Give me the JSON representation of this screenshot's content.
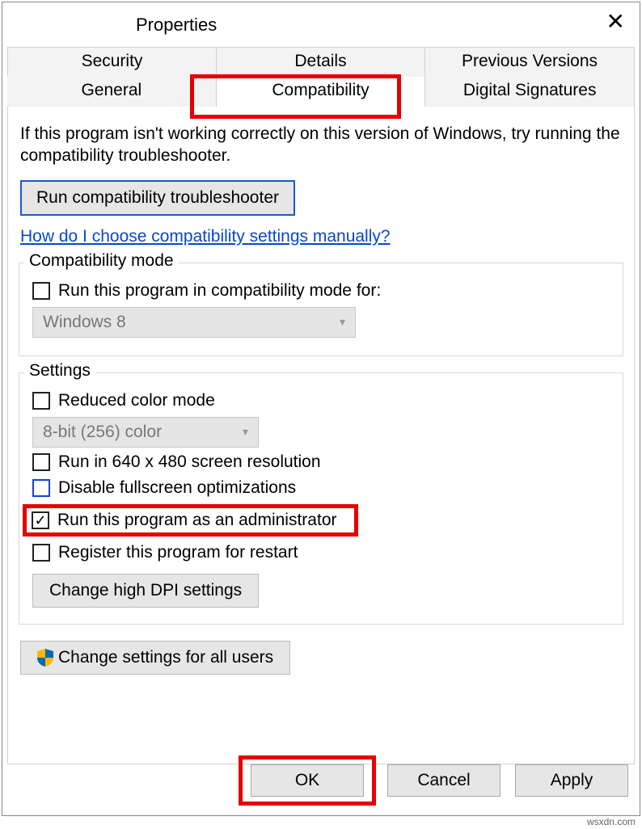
{
  "window": {
    "title": "Properties",
    "close": "✕"
  },
  "tabs": {
    "row1": [
      "Security",
      "Details",
      "Previous Versions"
    ],
    "row2": [
      "General",
      "Compatibility",
      "Digital Signatures"
    ],
    "active": "Compatibility"
  },
  "intro": "If this program isn't working correctly on this version of Windows, try running the compatibility troubleshooter.",
  "run_troubleshooter": "Run compatibility troubleshooter",
  "help_link": "How do I choose compatibility settings manually?",
  "compat_group": {
    "label": "Compatibility mode",
    "checkbox": "Run this program in compatibility mode for:",
    "combo_value": "Windows 8"
  },
  "settings_group": {
    "label": "Settings",
    "reduced_color": "Reduced color mode",
    "color_combo": "8-bit (256) color",
    "run_640": "Run in 640 x 480 screen resolution",
    "disable_fs": "Disable fullscreen optimizations",
    "run_admin": "Run this program as an administrator",
    "register_restart": "Register this program for restart",
    "dpi_button": "Change high DPI settings"
  },
  "all_users_button": "Change settings for all users",
  "footer": {
    "ok": "OK",
    "cancel": "Cancel",
    "apply": "Apply"
  },
  "watermark": "wsxdn.com"
}
